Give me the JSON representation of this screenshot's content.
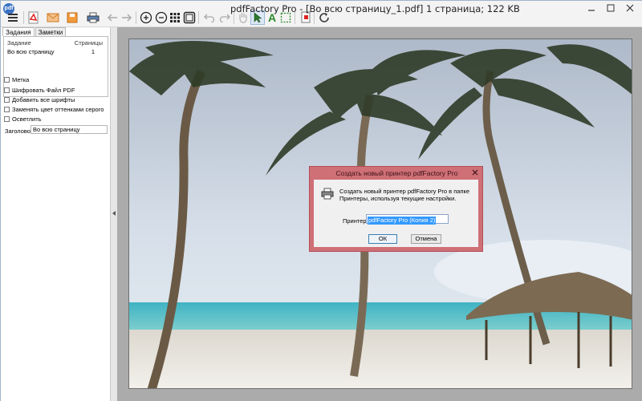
{
  "window": {
    "title": "pdfFactory Pro - [Во всю страницу_1.pdf] 1 страница; 122 KB",
    "app_icon_text": "pdf"
  },
  "toolbar": {
    "icons": [
      "menu-icon",
      "pdf-save-icon",
      "email-icon",
      "save-icon",
      "print-icon",
      "back-arrow-icon",
      "forward-arrow-icon",
      "zoom-in-icon",
      "zoom-out-icon",
      "thumbnails-icon",
      "fit-page-icon",
      "undo-icon",
      "redo-icon",
      "hand-tool-icon",
      "select-arrow-icon",
      "text-tool-icon",
      "marquee-select-icon",
      "stamp-icon",
      "refresh-icon"
    ]
  },
  "left_panel": {
    "tabs": [
      "Задания",
      "Заметки"
    ],
    "tasks_header": {
      "task": "Задание",
      "pages": "Страницы"
    },
    "tasks": [
      {
        "task": "Во всю страницу",
        "pages": "1"
      }
    ],
    "options": [
      "Метка",
      "Шифровать Файл PDF",
      "Добавить все шрифты",
      "Заменять цвет оттенками серого",
      "Осветлить"
    ],
    "header_label": "Заголовок:",
    "header_value": "Во всю страницу"
  },
  "dialog": {
    "title": "Создать новый принтер pdfFactory Pro",
    "message": "Создать новый принтер pdfFactory Pro в папке Принтеры, используя текущие настройки.",
    "printer_label": "Принтер:",
    "printer_value": "pdfFactory Pro (Копия 2)",
    "ok": "ОК",
    "cancel": "Отмена"
  },
  "colors": {
    "dialog_frame": "#cf6f76",
    "selection": "#3399ff"
  }
}
